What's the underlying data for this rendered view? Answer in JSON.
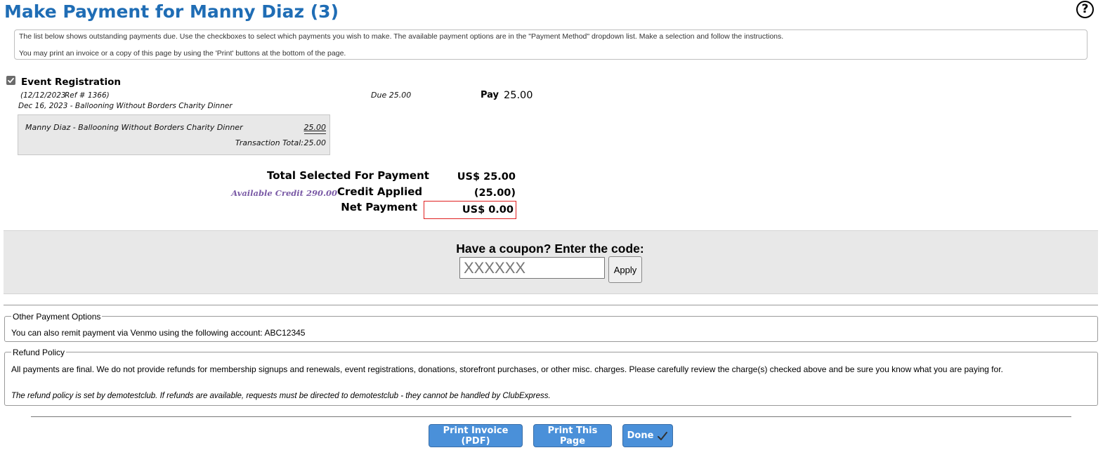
{
  "header": {
    "title": "Make Payment for Manny Diaz (3)",
    "help_symbol": "?"
  },
  "instructions": {
    "line1": "The list below shows outstanding payments due. Use the checkboxes to select which payments you wish to make. The available payment options are in the \"Payment Method\" dropdown list. Make a selection and follow the instructions.",
    "line2": "You may print an invoice or a copy of this page by using the 'Print' buttons at the bottom of the page."
  },
  "item": {
    "checked": true,
    "title": "Event Registration",
    "date": "(12/12/2023",
    "ref": "Ref # 1366)",
    "description": "Dec 16, 2023 - Ballooning Without Borders Charity Dinner",
    "due": "Due 25.00",
    "pay_label": "Pay",
    "pay_amount": "25.00",
    "transaction": {
      "line_label": "Manny Diaz - Ballooning Without Borders Charity Dinner",
      "line_amount": "25.00",
      "total_label": "Transaction Total:",
      "total_amount": "25.00"
    }
  },
  "totals": {
    "selected_label": "Total Selected For Payment",
    "selected_value": "US$ 25.00",
    "available_credit": "Available Credit 290.00",
    "credit_label": "Credit Applied",
    "credit_value": "(25.00)",
    "net_label": "Net Payment",
    "net_value": "US$ 0.00"
  },
  "coupon": {
    "title": "Have a coupon? Enter the code:",
    "placeholder": "XXXXXX",
    "apply_label": "Apply"
  },
  "other_options": {
    "legend": "Other Payment Options",
    "text": "You can also remit payment via Venmo using the following account: ABC12345"
  },
  "refund": {
    "legend": "Refund Policy",
    "text": "All payments are final. We do not provide refunds for membership signups and renewals, event registrations, donations, storefront purchases, or other misc. charges. Please carefully review the charge(s) checked above and be sure you know what you are paying for.",
    "note": "The refund policy is set by demotestclub. If refunds are available, requests must be directed to demotestclub - they cannot be handled by ClubExpress."
  },
  "buttons": {
    "invoice": "Print Invoice (PDF)",
    "print": "Print This Page",
    "done": "Done"
  },
  "colors": {
    "title": "#1f6db5",
    "button": "#4a90d9",
    "credit": "#7a5aa6",
    "net_border": "#e02020",
    "panel": "#e8e8e8"
  }
}
